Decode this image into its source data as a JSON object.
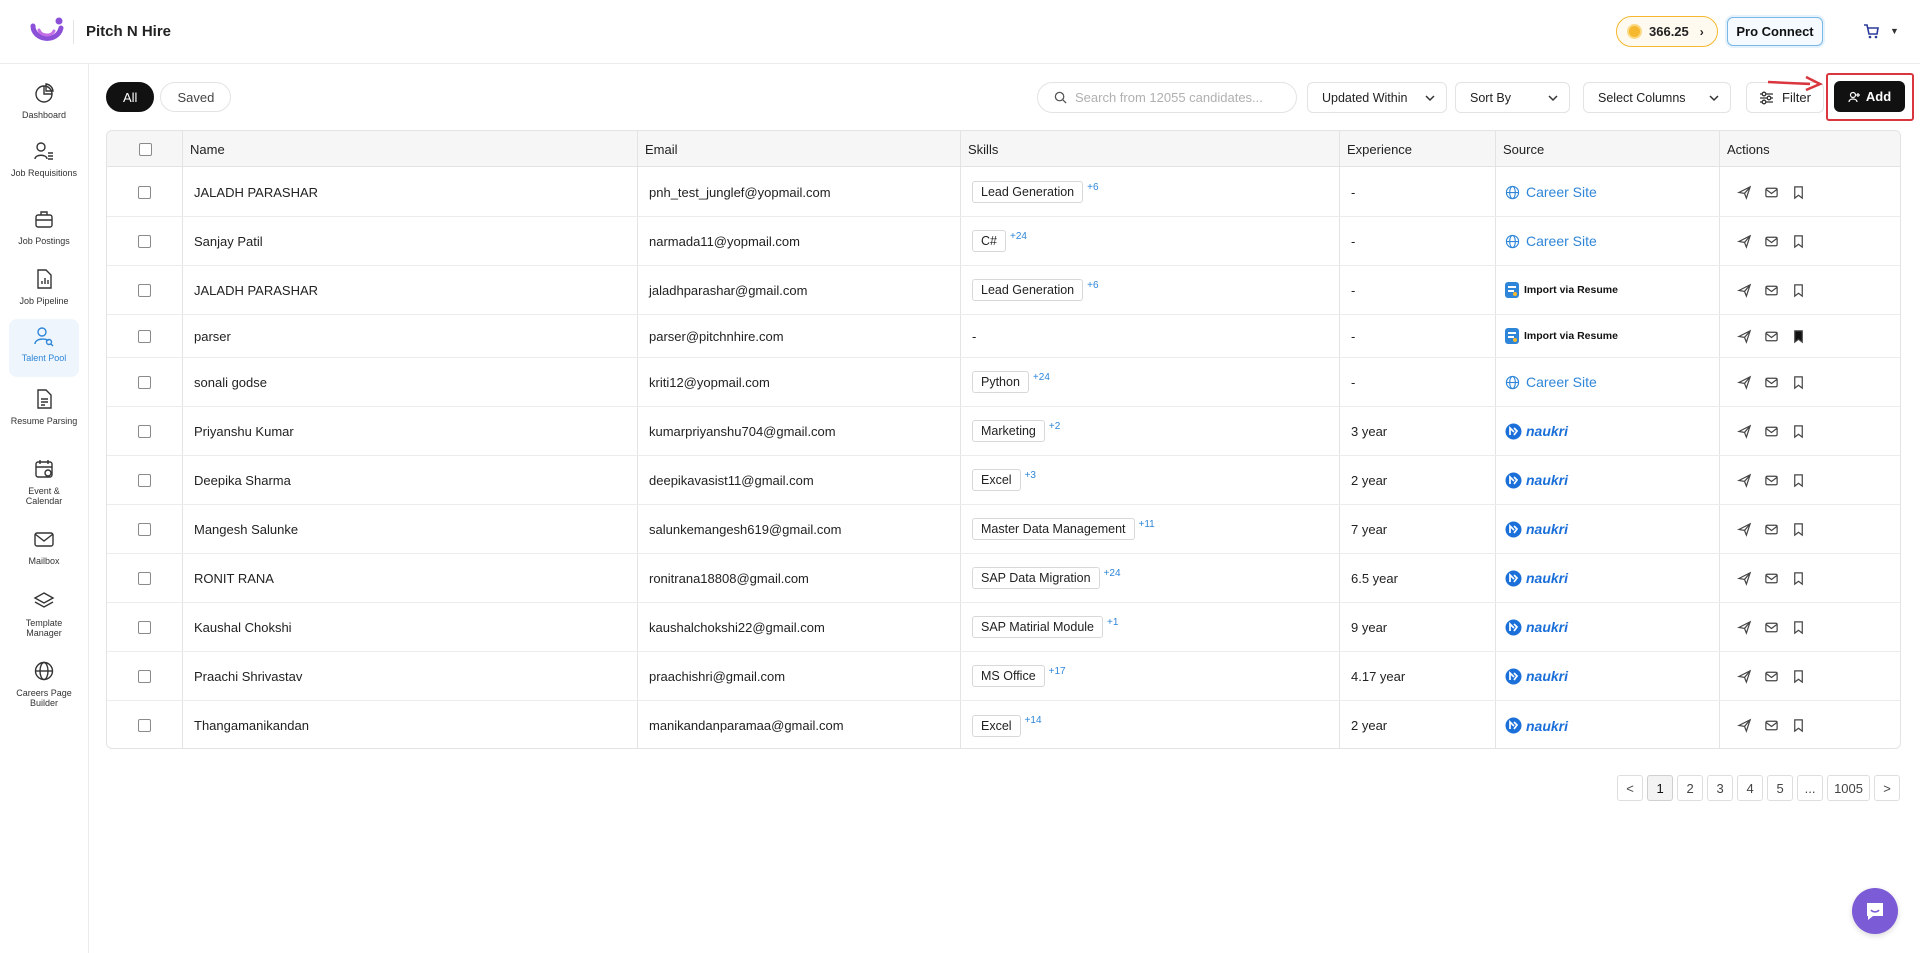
{
  "header": {
    "brand": "Pitch N Hire",
    "coins": "366.25",
    "pro_connect": "Pro Connect",
    "colors": {
      "coin_border": "#f5b82e",
      "pro_border": "#7ab8e8",
      "logo": "#8b4fd8"
    }
  },
  "sidebar": {
    "items": [
      {
        "label": "Dashboard",
        "icon": "pie-chart-icon"
      },
      {
        "label": "Job Requisitions",
        "icon": "user-list-icon"
      },
      {
        "label": "Job Postings",
        "icon": "briefcase-icon"
      },
      {
        "label": "Job Pipeline",
        "icon": "document-chart-icon"
      },
      {
        "label": "Talent Pool",
        "icon": "users-search-icon",
        "active": true
      },
      {
        "label": "Resume Parsing",
        "icon": "document-icon"
      },
      {
        "label": "Event & Calendar",
        "icon": "calendar-icon"
      },
      {
        "label": "Mailbox",
        "icon": "mail-icon"
      },
      {
        "label": "Template Manager",
        "icon": "layers-icon"
      },
      {
        "label": "Careers Page Builder",
        "icon": "globe-icon"
      }
    ],
    "active_color": "#2f86d8"
  },
  "toolbar": {
    "tab_all": "All",
    "tab_saved": "Saved",
    "search_placeholder": "Search from 12055 candidates...",
    "updated_within": "Updated Within",
    "sort_by": "Sort By",
    "select_columns": "Select Columns",
    "filter": "Filter",
    "add": "Add"
  },
  "table": {
    "columns": [
      "Name",
      "Email",
      "Skills",
      "Experience",
      "Source",
      "Actions"
    ],
    "rows": [
      {
        "name": "JALADH PARASHAR",
        "email": "pnh_test_junglef@yopmail.com",
        "skill": "Lead Generation",
        "more": "+6",
        "experience": "-",
        "source": "Career Site",
        "source_type": "career",
        "bookmarked": false
      },
      {
        "name": "Sanjay Patil",
        "email": "narmada11@yopmail.com",
        "skill": "C#",
        "more": "+24",
        "experience": "-",
        "source": "Career Site",
        "source_type": "career",
        "bookmarked": false
      },
      {
        "name": "JALADH PARASHAR",
        "email": "jaladhparashar@gmail.com",
        "skill": "Lead Generation",
        "more": "+6",
        "experience": "-",
        "source": "Import via Resume",
        "source_type": "import",
        "bookmarked": false
      },
      {
        "name": "parser",
        "email": "parser@pitchnhire.com",
        "skill": "-",
        "more": "",
        "experience": "-",
        "source": "Import via Resume",
        "source_type": "import",
        "bookmarked": true
      },
      {
        "name": "sonali godse",
        "email": "kriti12@yopmail.com",
        "skill": "Python",
        "more": "+24",
        "experience": "-",
        "source": "Career Site",
        "source_type": "career",
        "bookmarked": false
      },
      {
        "name": "Priyanshu Kumar",
        "email": "kumarpriyanshu704@gmail.com",
        "skill": "Marketing",
        "more": "+2",
        "experience": "3 year",
        "source": "naukri",
        "source_type": "naukri",
        "bookmarked": false
      },
      {
        "name": "Deepika Sharma",
        "email": "deepikavasist11@gmail.com",
        "skill": "Excel",
        "more": "+3",
        "experience": "2 year",
        "source": "naukri",
        "source_type": "naukri",
        "bookmarked": false
      },
      {
        "name": "Mangesh Salunke",
        "email": "salunkemangesh619@gmail.com",
        "skill": "Master Data Management",
        "more": "+11",
        "experience": "7 year",
        "source": "naukri",
        "source_type": "naukri",
        "bookmarked": false
      },
      {
        "name": "RONIT RANA",
        "email": "ronitrana18808@gmail.com",
        "skill": "SAP Data Migration",
        "more": "+24",
        "experience": "6.5 year",
        "source": "naukri",
        "source_type": "naukri",
        "bookmarked": false
      },
      {
        "name": "Kaushal Chokshi",
        "email": "kaushalchokshi22@gmail.com",
        "skill": "SAP Matirial Module",
        "more": "+1",
        "experience": "9 year",
        "source": "naukri",
        "source_type": "naukri",
        "bookmarked": false
      },
      {
        "name": "Praachi Shrivastav",
        "email": "praachishri@gmail.com",
        "skill": "MS Office",
        "more": "+17",
        "experience": "4.17 year",
        "source": "naukri",
        "source_type": "naukri",
        "bookmarked": false
      },
      {
        "name": "Thangamanikandan",
        "email": "manikandanparamaa@gmail.com",
        "skill": "Excel",
        "more": "+14",
        "experience": "2 year",
        "source": "naukri",
        "source_type": "naukri",
        "bookmarked": false
      }
    ]
  },
  "pagination": {
    "prev": "<",
    "pages": [
      "1",
      "2",
      "3",
      "4",
      "5",
      "...",
      "1005"
    ],
    "current": "1",
    "next": ">"
  }
}
